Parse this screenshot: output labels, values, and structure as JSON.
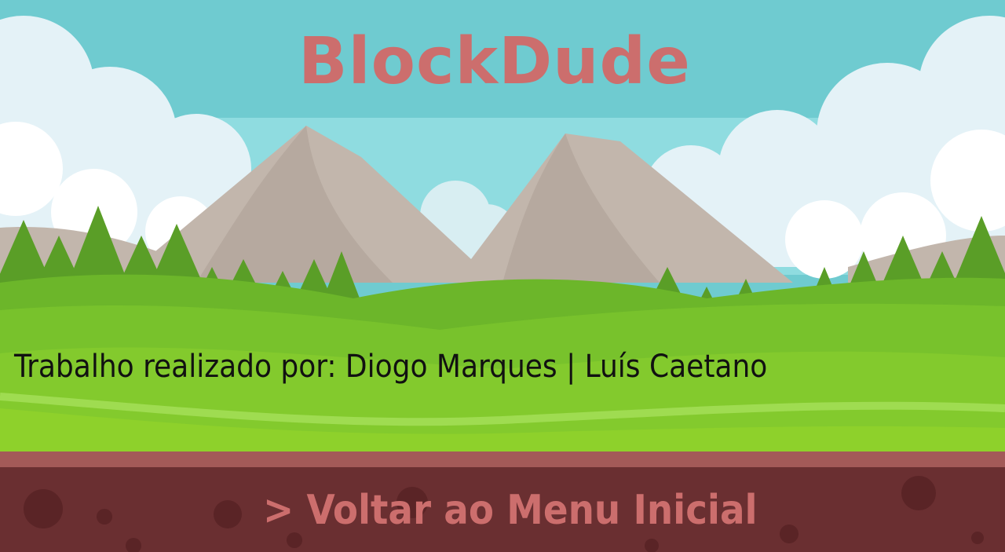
{
  "game": {
    "title": "BlockDude"
  },
  "credits": {
    "text": "Trabalho realizado por: Diogo Marques | Luís Caetano"
  },
  "menu": {
    "back_label": "> Voltar ao Menu Inicial"
  },
  "colors": {
    "title": "#cc6e6d",
    "credits_text": "#111111",
    "menu_text": "#cc6e6d",
    "sky": "#6fcbd0",
    "grass": "#8ed12b",
    "soil": "#6a2f31",
    "soil_top": "#a35a58"
  },
  "icons": {
    "menu_arrow": ">"
  }
}
